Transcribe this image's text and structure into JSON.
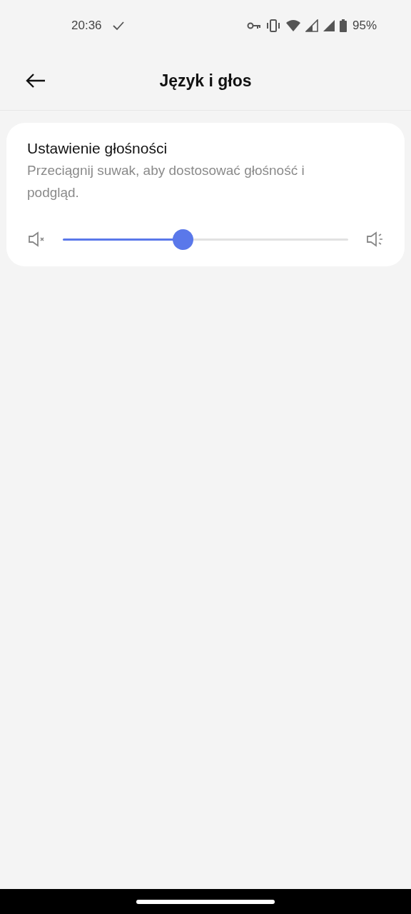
{
  "status_bar": {
    "time": "20:36",
    "battery": "95%"
  },
  "header": {
    "title": "Język i głos"
  },
  "volume_card": {
    "title": "Ustawienie głośności",
    "description": "Przeciągnij suwak, aby dostosować głośność i podgląd.",
    "level": 0.42
  }
}
